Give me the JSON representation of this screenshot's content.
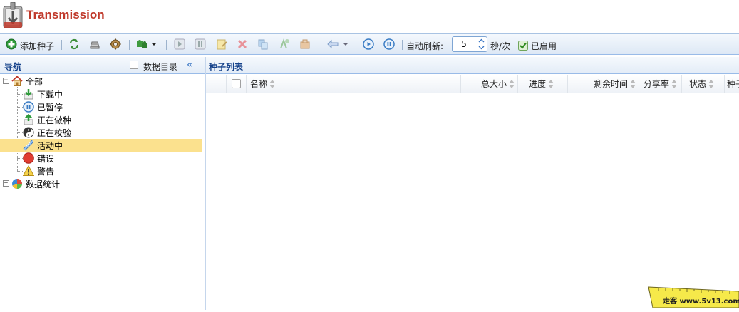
{
  "app": {
    "title": "Transmission"
  },
  "toolbar": {
    "add_torrent_label": "添加种子",
    "auto_refresh_label": "自动刷新:",
    "refresh_interval": "5",
    "refresh_unit": "秒/次",
    "enabled_label": "已启用",
    "enabled_checked": true
  },
  "nav": {
    "title": "导航",
    "category_checkbox_label": "数据目录",
    "items": [
      {
        "label": "全部",
        "icon": "home-icon"
      },
      {
        "label": "下载中",
        "icon": "download-icon"
      },
      {
        "label": "已暂停",
        "icon": "pause-icon"
      },
      {
        "label": "正在做种",
        "icon": "upload-icon"
      },
      {
        "label": "正在校验",
        "icon": "checking-icon"
      },
      {
        "label": "活动中",
        "icon": "active-icon",
        "selected": true
      },
      {
        "label": "错误",
        "icon": "error-icon"
      },
      {
        "label": "警告",
        "icon": "warning-icon"
      },
      {
        "label": "数据统计",
        "icon": "pie-chart-icon"
      }
    ]
  },
  "torrent_list": {
    "title": "种子列表",
    "columns": [
      "名称",
      "总大小",
      "进度",
      "剩余时间",
      "分享率",
      "状态",
      "种子"
    ],
    "rows": []
  },
  "watermark": {
    "text": "走客 www.5v13.com"
  },
  "colors": {
    "accent": "#15428b",
    "selected": "#fbe18e",
    "title": "#c0392b"
  }
}
